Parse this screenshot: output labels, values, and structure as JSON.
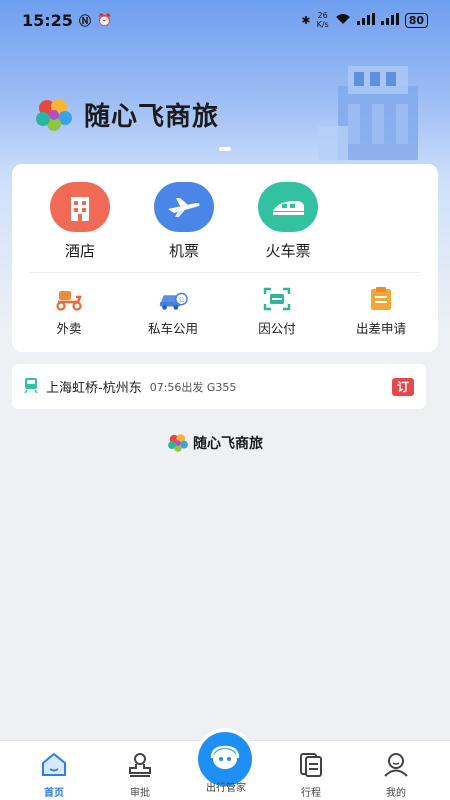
{
  "status_bar": {
    "time": "15:25",
    "net_speed_top": "26",
    "net_speed_unit": "K/s",
    "battery": "80"
  },
  "brand": {
    "name": "随心飞商旅"
  },
  "main_services": [
    {
      "label": "酒店",
      "icon": "hotel-icon",
      "color": "#f06a55"
    },
    {
      "label": "机票",
      "icon": "airplane-icon",
      "color": "#4a86e8"
    },
    {
      "label": "火车票",
      "icon": "train-icon",
      "color": "#33c2a0"
    }
  ],
  "sub_services": [
    {
      "label": "外卖",
      "icon": "scooter-icon"
    },
    {
      "label": "私车公用",
      "icon": "private-car-icon"
    },
    {
      "label": "因公付",
      "icon": "scan-pay-icon"
    },
    {
      "label": "出差申请",
      "icon": "application-icon"
    }
  ],
  "trip": {
    "route": "上海虹桥-杭州东",
    "meta": "07:56出发 G355",
    "badge": "订"
  },
  "footer_brand": {
    "name": "随心飞商旅"
  },
  "tabs": [
    {
      "label": "首页",
      "icon": "home-icon",
      "active": true
    },
    {
      "label": "审批",
      "icon": "approval-icon",
      "active": false
    },
    {
      "label": "出行管家",
      "icon": "assistant-icon",
      "active": false
    },
    {
      "label": "行程",
      "icon": "itinerary-icon",
      "active": false
    },
    {
      "label": "我的",
      "icon": "profile-icon",
      "active": false
    }
  ],
  "colors": {
    "accent": "#2f7de6",
    "badge": "#e8474b",
    "center_button": "#1e90f5"
  }
}
